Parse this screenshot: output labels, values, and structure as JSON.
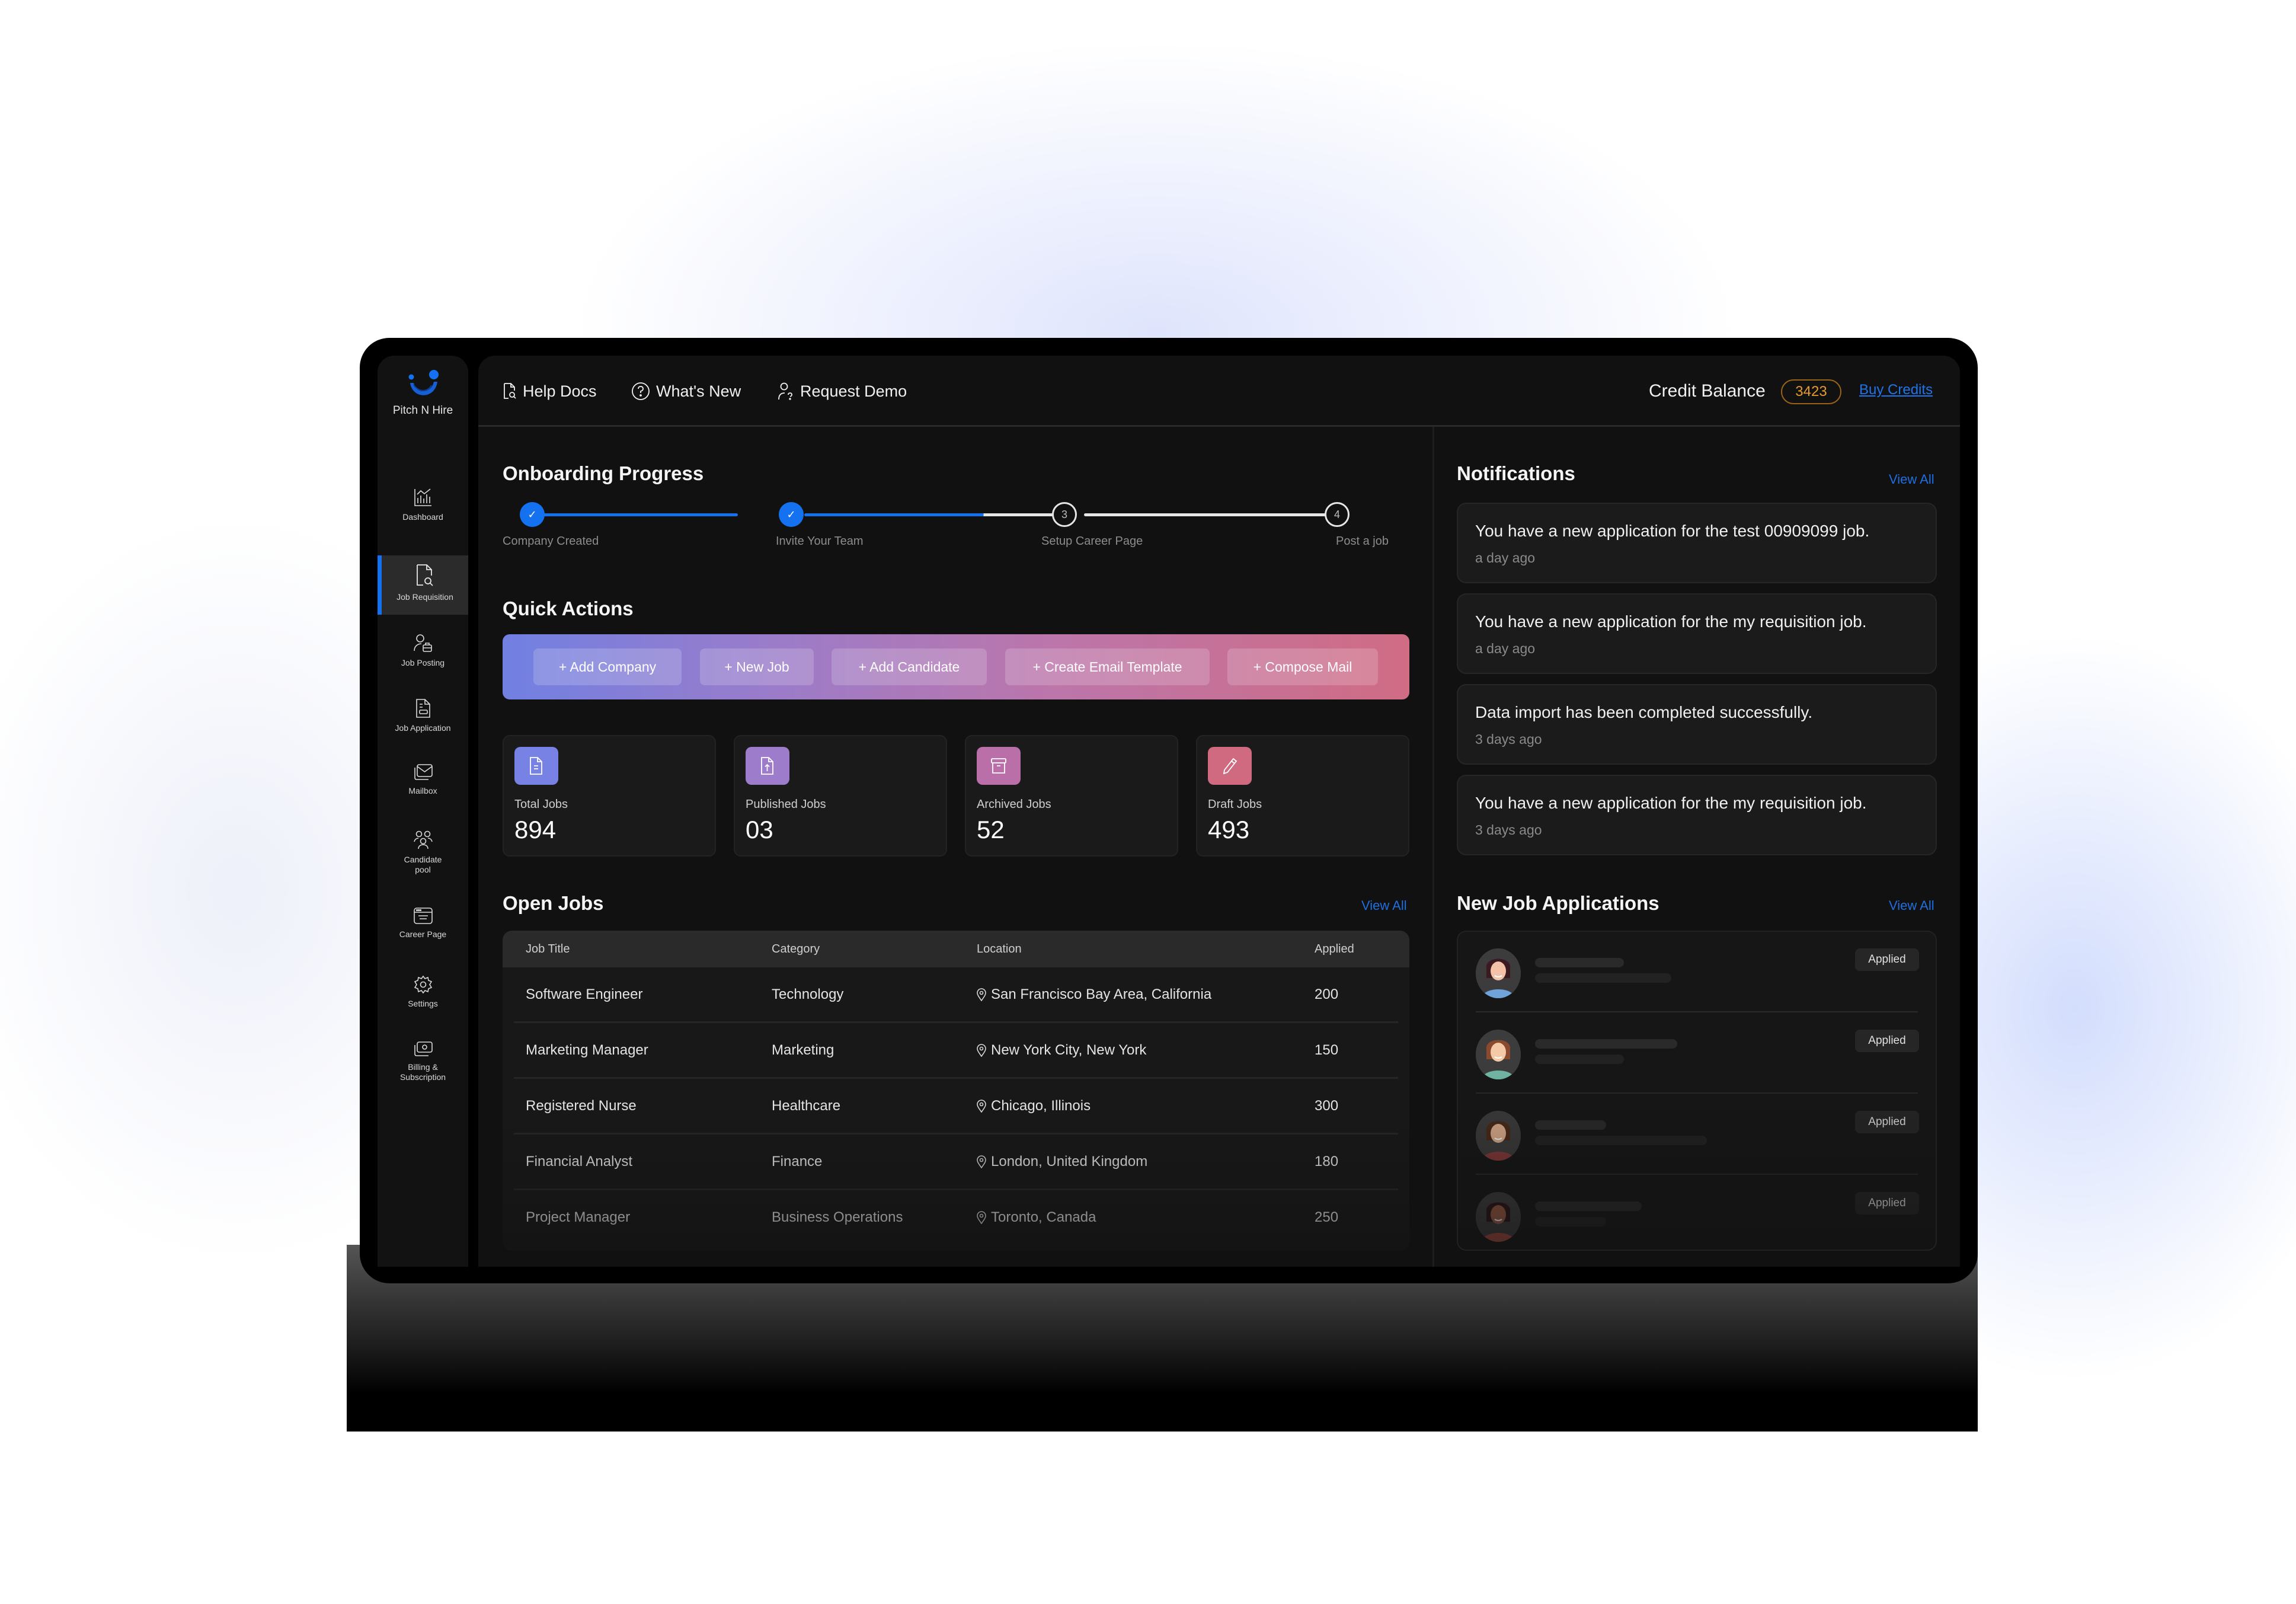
{
  "app": {
    "name": "Pitch N Hire"
  },
  "sidebar": {
    "items": [
      {
        "label": "Dashboard",
        "icon": "chart-icon",
        "active": false
      },
      {
        "label": "Job Requisition",
        "icon": "document-search-icon",
        "active": true
      },
      {
        "label": "Job Posting",
        "icon": "user-briefcase-icon",
        "active": false
      },
      {
        "label": "Job Application",
        "icon": "document-icon",
        "active": false
      },
      {
        "label": "Mailbox",
        "icon": "mail-icon",
        "active": false
      },
      {
        "label": "Candidate pool",
        "icon": "users-icon",
        "active": false
      },
      {
        "label": "Career Page",
        "icon": "browser-icon",
        "active": false
      },
      {
        "label": "Settings",
        "icon": "gear-icon",
        "active": false
      },
      {
        "label": "Billing & Subscription",
        "icon": "billing-icon",
        "active": false
      }
    ]
  },
  "topbar": {
    "help_docs": "Help Docs",
    "whats_new": "What's New",
    "request_demo": "Request Demo",
    "credit_label": "Credit Balance",
    "credit_value": "3423",
    "buy_credits": "Buy Credits"
  },
  "onboarding": {
    "title": "Onboarding Progress",
    "steps": [
      {
        "label": "Company Created",
        "marker": "✓",
        "status": "done"
      },
      {
        "label": "Invite Your Team",
        "marker": "✓",
        "status": "done"
      },
      {
        "label": "Setup Career Page",
        "marker": "3",
        "status": "todo"
      },
      {
        "label": "Post a job",
        "marker": "4",
        "status": "todo"
      }
    ],
    "progress_fraction_segment_2": 0.72
  },
  "quick_actions": {
    "title": "Quick Actions",
    "buttons": [
      "+ Add Company",
      "+ New Job",
      "+ Add Candidate",
      "+ Create Email Template",
      "+ Compose Mail"
    ]
  },
  "stats": [
    {
      "label": "Total Jobs",
      "value": "894",
      "color": "#7882e4",
      "icon": "document-icon"
    },
    {
      "label": "Published Jobs",
      "value": "03",
      "color": "#9d7ccb",
      "icon": "upload-document-icon"
    },
    {
      "label": "Archived Jobs",
      "value": "52",
      "color": "#bb6fa8",
      "icon": "archive-icon"
    },
    {
      "label": "Draft Jobs",
      "value": "493",
      "color": "#cf6a80",
      "icon": "pencil-icon"
    }
  ],
  "open_jobs": {
    "title": "Open Jobs",
    "view_all": "View All",
    "columns": [
      "Job Title",
      "Category",
      "Location",
      "Applied"
    ],
    "rows": [
      {
        "title": "Software Engineer",
        "category": "Technology",
        "location": "San Francisco Bay Area, California",
        "applied": "200"
      },
      {
        "title": "Marketing Manager",
        "category": "Marketing",
        "location": "New York City, New York",
        "applied": "150"
      },
      {
        "title": "Registered Nurse",
        "category": "Healthcare",
        "location": "Chicago, Illinois",
        "applied": "300"
      },
      {
        "title": "Financial Analyst",
        "category": "Finance",
        "location": "London, United Kingdom",
        "applied": "180"
      },
      {
        "title": "Project Manager",
        "category": "Business Operations",
        "location": "Toronto, Canada",
        "applied": "250"
      }
    ]
  },
  "notifications": {
    "title": "Notifications",
    "view_all": "View All",
    "items": [
      {
        "message": "You have a new application for the test 00909099 job.",
        "time": "a day ago"
      },
      {
        "message": "You have a new application for the my requisition job.",
        "time": "a day ago"
      },
      {
        "message": "Data import has been completed successfully.",
        "time": "3 days ago"
      },
      {
        "message": "You have a new application for the my requisition job.",
        "time": "3 days ago"
      }
    ]
  },
  "applications": {
    "title": "New Job Applications",
    "view_all": "View All",
    "items": [
      {
        "status": "Applied",
        "avatar": "avatar-woman-dark-hair"
      },
      {
        "status": "Applied",
        "avatar": "avatar-woman-brown-hair"
      },
      {
        "status": "Applied",
        "avatar": "avatar-man-glasses"
      },
      {
        "status": "Applied",
        "avatar": "avatar-woman-dark-skin"
      }
    ]
  },
  "colors": {
    "accent": "#1472f0",
    "credit": "#e79a2e",
    "link": "#1f6fe0"
  }
}
